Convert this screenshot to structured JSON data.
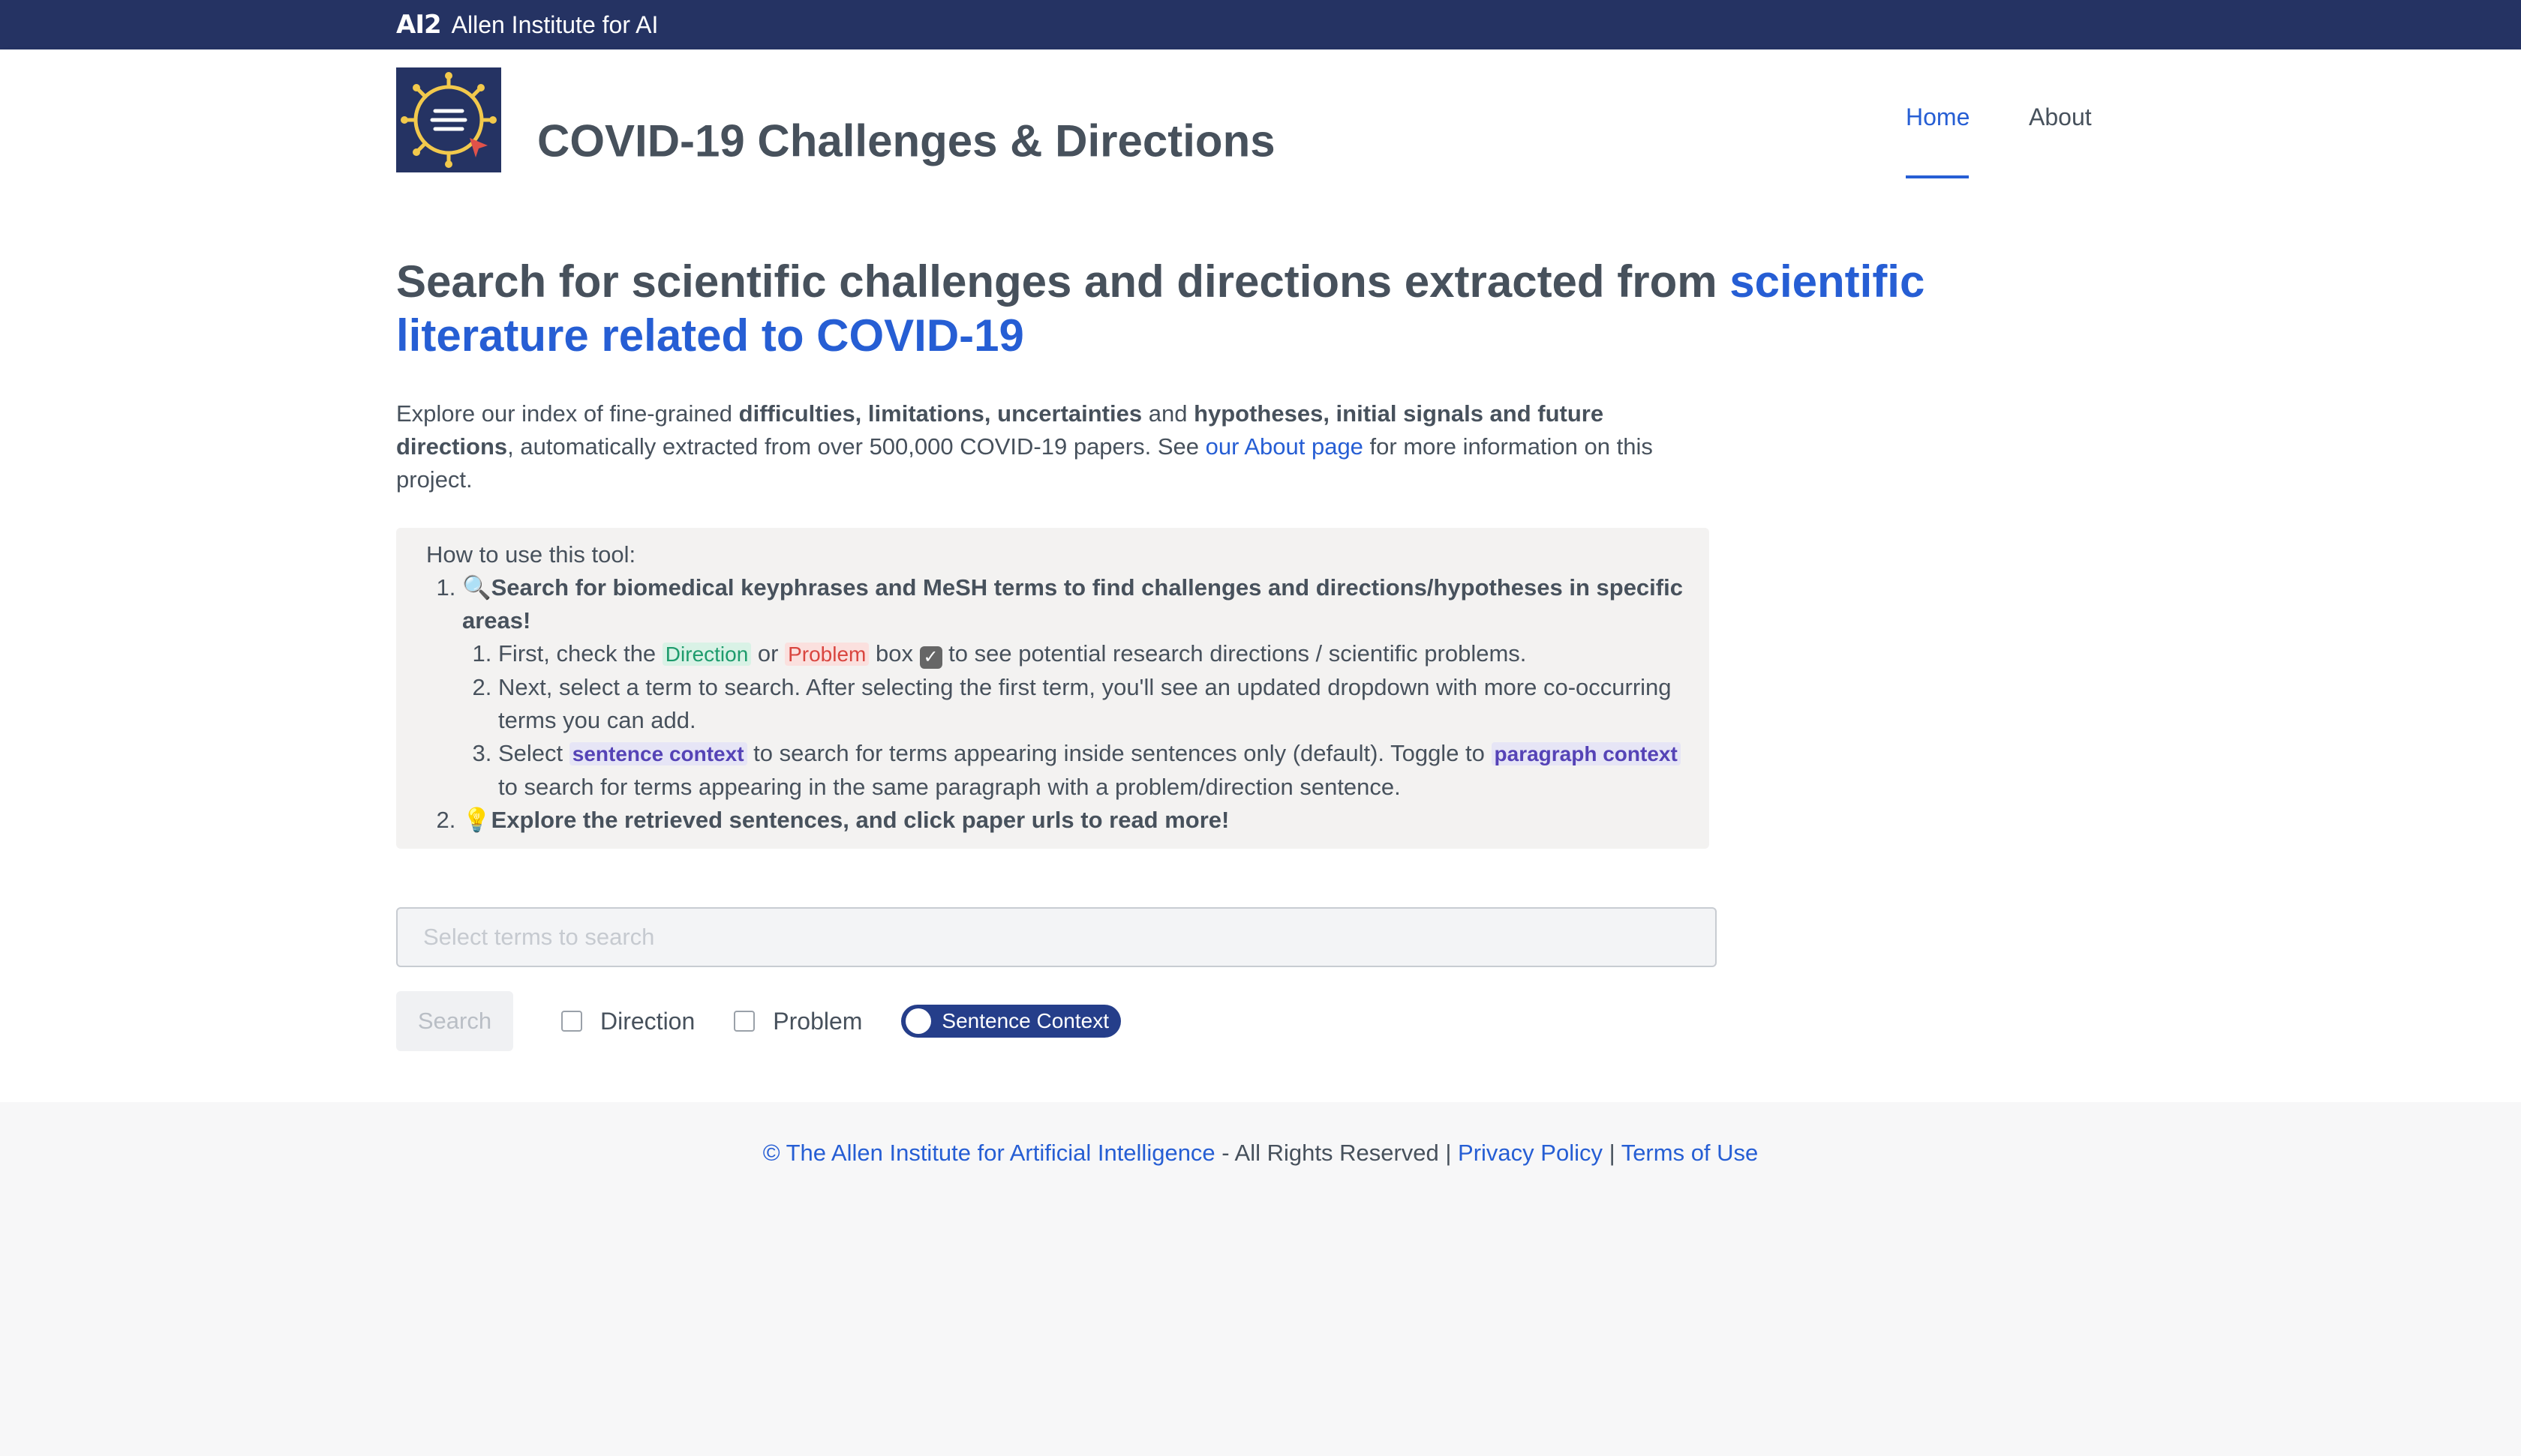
{
  "topbar": {
    "mark": "AI2",
    "name": "Allen Institute for AI"
  },
  "header": {
    "logo_icon": "covid-virus-list-icon",
    "title": "COVID-19 Challenges & Directions",
    "nav": [
      {
        "label": "Home",
        "active": true
      },
      {
        "label": "About",
        "active": false
      }
    ]
  },
  "headline": {
    "text": "Search for scientific challenges and directions extracted from ",
    "link": "scientific literature related to COVID-19"
  },
  "intro": {
    "p1": "Explore our index of fine-grained ",
    "b1": "difficulties, limitations, uncertainties",
    "p2": " and ",
    "b2": "hypotheses, initial signals and future directions",
    "p3": ", automatically extracted from over 500,000 COVID-19 papers. See ",
    "link": "our About page",
    "p4": " for more information on this project."
  },
  "howto": {
    "title": "How to use this tool:",
    "step1": {
      "icon": "🔍",
      "text": "Search for biomedical keyphrases and MeSH terms to find challenges and directions/hypotheses in specific areas!",
      "sub1": {
        "a": "First, check the ",
        "tag_direction": "Direction",
        "b": " or ",
        "tag_problem": "Problem",
        "c": " box ",
        "check": "✓",
        "d": " to see potential research directions / scientific problems."
      },
      "sub2": "Next, select a term to search. After selecting the first term, you'll see an updated dropdown with more co-occurring terms you can add.",
      "sub3": {
        "a": "Select ",
        "tag_sentence": "sentence context",
        "b": " to search for terms appearing inside sentences only (default). Toggle to ",
        "tag_paragraph": "paragraph context",
        "c": " to search for terms appearing in the same paragraph with a problem/direction sentence."
      }
    },
    "step2": {
      "icon": "💡",
      "text": "Explore the retrieved sentences, and click paper urls to read more!"
    }
  },
  "search": {
    "placeholder": "Select terms to search",
    "button": "Search",
    "checkbox_direction": "Direction",
    "checkbox_problem": "Problem",
    "toggle_label": "Sentence Context"
  },
  "footer": {
    "copyright_link": "© The Allen Institute for Artificial Intelligence",
    "rights": " - All Rights Reserved | ",
    "privacy": "Privacy Policy",
    "sep": " | ",
    "terms": "Terms of Use"
  },
  "colors": {
    "brand_navy": "#253363",
    "link_blue": "#265ed4",
    "toggle_navy": "#253e8a"
  }
}
